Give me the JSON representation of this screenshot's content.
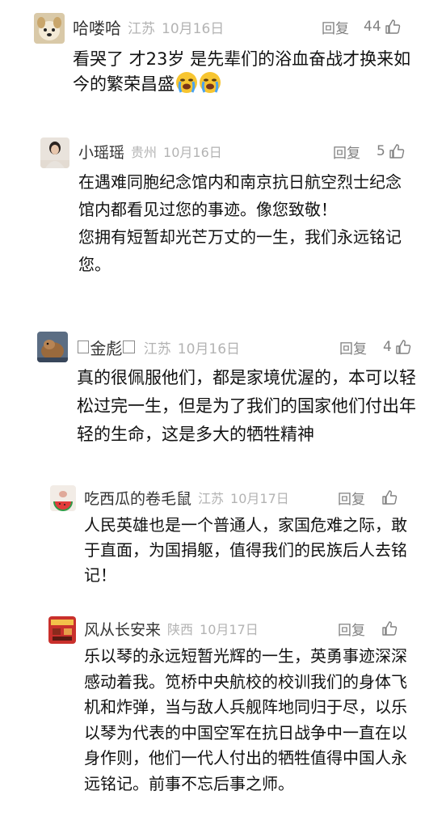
{
  "comments": [
    {
      "user": "哈喽哈",
      "location": "江苏",
      "date": "10月16日",
      "reply_label": "回复",
      "likes": "44",
      "text": "看哭了 才23岁 是先辈们的浴血奋战才换来如今的繁荣昌盛",
      "emoji": "loudly-crying-face"
    },
    {
      "user": "小瑶瑶",
      "location": "贵州",
      "date": "10月16日",
      "reply_label": "回复",
      "likes": "5",
      "text": "在遇难同胞纪念馆内和南京抗日航空烈士纪念馆内都看见过您的事迹。像您致敬！\n您拥有短暂却光芒万丈的一生，我们永远铭记您。"
    },
    {
      "user": "金彪",
      "location": "江苏",
      "date": "10月16日",
      "reply_label": "回复",
      "likes": "4",
      "text": "真的很佩服他们，都是家境优渥的，本可以轻松过完一生，但是为了我们的国家他们付出年轻的生命，这是多大的牺牲精神"
    }
  ],
  "replies": [
    {
      "user": "吃西瓜的卷毛鼠",
      "location": "江苏",
      "date": "10月17日",
      "reply_label": "回复",
      "text": "人民英雄也是一个普通人，家国危难之际，敢于直面，为国捐躯，值得我们的民族后人去铭记！"
    },
    {
      "user": "风从长安来",
      "location": "陕西",
      "date": "10月17日",
      "reply_label": "回复",
      "text": "乐以琴的永远短暂光辉的一生，英勇事迹深深感动着我。笕桥中央航校的校训我们的身体飞机和炸弹，当与敌人兵舰阵地同归于尽，以乐以琴为代表的中国空军在抗日战争中一直在以身作则，他们一代人付出的牺牲值得中国人永远铭记。前事不忘后事之师。"
    }
  ]
}
